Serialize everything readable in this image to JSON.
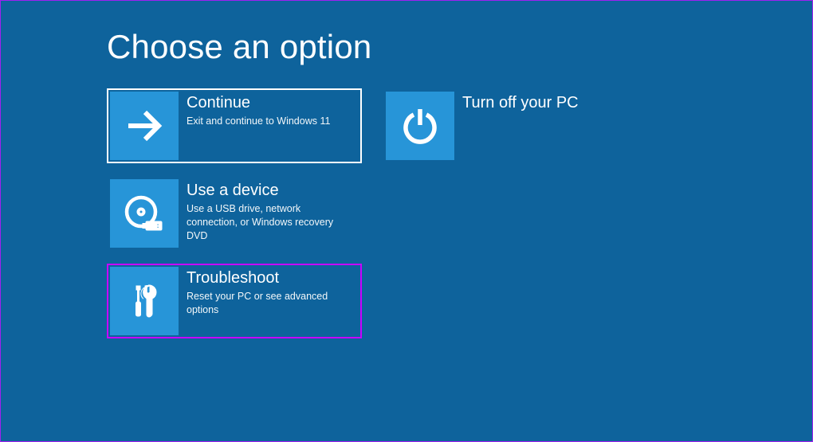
{
  "page_title": "Choose an option",
  "options": {
    "continue": {
      "title": "Continue",
      "desc": "Exit and continue to Windows 11",
      "icon": "arrow-right-icon"
    },
    "turnoff": {
      "title": "Turn off your PC",
      "desc": "",
      "icon": "power-icon"
    },
    "device": {
      "title": "Use a device",
      "desc": "Use a USB drive, network connection, or Windows recovery DVD",
      "icon": "disc-usb-icon"
    },
    "troubleshoot": {
      "title": "Troubleshoot",
      "desc": "Reset your PC or see advanced options",
      "icon": "tools-icon"
    }
  },
  "colors": {
    "background": "#0e639c",
    "tile": "#2795d8",
    "highlight_border": "#c800ff",
    "selected_border": "#ffffff"
  }
}
